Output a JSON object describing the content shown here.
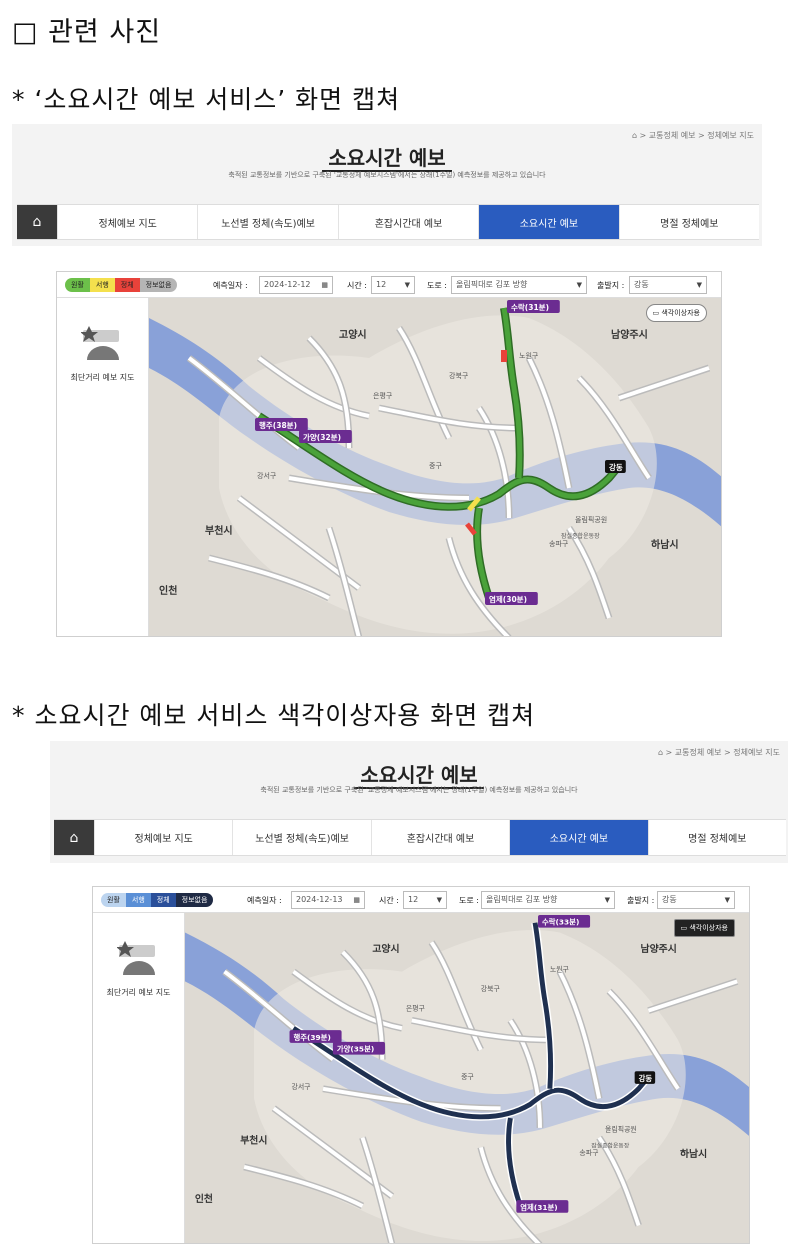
{
  "heading": "□ 관련 사진",
  "captions": {
    "first": "* ‘소요시간 예보 서비스’ 화면 캡쳐",
    "second": "* 소요시간 예보 서비스 색각이상자용 화면 캡쳐"
  },
  "portal": {
    "breadcrumb": "⌂  >  교통정체 예보  >  정체예보 지도",
    "title": "소요시간 예보",
    "subtitle": "축적된 교통정보를 기반으로 구축된 '교통정체 예보시스템'에서는 장래(1주일) 예측정보를 제공하고 있습니다",
    "tabs": [
      "정체예보 지도",
      "노선별 정체(속도)예보",
      "혼잡시간대 예보",
      "소요시간 예보",
      "명절 정체예보"
    ],
    "active_tab": "소요시간 예보",
    "home_icon": "home-icon"
  },
  "service1": {
    "legend": [
      "원활",
      "서행",
      "정체",
      "정보없음"
    ],
    "legend_colors": [
      "#6cc04a",
      "#f4e04d",
      "#e8423a",
      "#b5b5b5"
    ],
    "date_label": "예측일자 :",
    "date_value": "2024-12-12",
    "time_label": "시간 :",
    "time_value": "12",
    "road_label": "도로 :",
    "road_value": "올림픽대로 김포 방향",
    "origin_label": "출발지 :",
    "origin_value": "강동",
    "cvd_button": "색각이상자용",
    "side_label": "최단거리 예보 지도",
    "route_color": "#4aa23a",
    "labels": {
      "suyak": "수락(31분)",
      "haengju": "행주(38분)",
      "gayang": "가양(32분)",
      "yeongje": "염제(30분)",
      "gangdong": "강동"
    }
  },
  "service2": {
    "legend": [
      "원활",
      "서행",
      "정체",
      "정보없음"
    ],
    "legend_colors": [
      "#bcd4ef",
      "#5a8fd6",
      "#2a4f9a",
      "#1f2a44"
    ],
    "date_label": "예측일자 :",
    "date_value": "2024-12-13",
    "time_label": "시간 :",
    "time_value": "12",
    "road_label": "도로 :",
    "road_value": "올림픽대로 김포 방향",
    "origin_label": "출발지 :",
    "origin_value": "강동",
    "cvd_button": "색각이상자용",
    "side_label": "최단거리 예보 지도",
    "route_color": "#1f3050",
    "labels": {
      "suyak": "수락(33분)",
      "haengju": "행주(39분)",
      "gayang": "가양(35분)",
      "yeongje": "염제(31분)",
      "gangdong": "강동"
    }
  },
  "map_places": {
    "goyang": "고양시",
    "namyangju": "남양주시",
    "bucheon": "부천시",
    "hanam": "하남시",
    "incheon": "인천",
    "gangseo": "강서구",
    "gangbuk": "강북구",
    "songpa": "송파구",
    "jung": "중구",
    "eunpyeong": "은평구",
    "nowon": "노원구",
    "olympic": "올림픽공원",
    "jamsil": "잠실종합운동장"
  }
}
